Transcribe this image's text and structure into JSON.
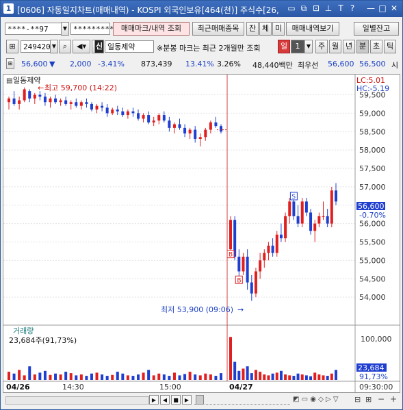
{
  "window": {
    "number": "1",
    "title": "[0606] 자동일지차트(매매내역) - KOSPI 외국인보유[464(천)] 주식수[26,"
  },
  "toolbar1": {
    "account": "****-**97",
    "password": "*********",
    "trade_mark_btn": "매매마크/내역 조회",
    "recent_trades_btn": "최근매매종목",
    "bal_btn": "잔",
    "exec_btn": "체",
    "unexec_btn": "미",
    "view_trades_btn": "매매내역보기",
    "daily_balance_btn": "일별잔고"
  },
  "toolbar2": {
    "stock_code": "249420",
    "credit_badge": "신",
    "stock_name": "일동제약",
    "notice": "※분봉 마크는 최근 2개월만 조회",
    "period_day": "일",
    "period_value": "1",
    "btn_week": "주",
    "btn_month": "월",
    "btn_year": "년",
    "btn_minute": "분",
    "btn_second": "초",
    "btn_tick": "틱"
  },
  "quote": {
    "price": "56,600",
    "arrow": "▼",
    "change": "2,000",
    "change_pct": "-3.41%",
    "volume": "873,439",
    "turnover": "13.41%",
    "ratio": "3.26%",
    "amount": "48,440백만",
    "best_ask_label": "최우선",
    "best_bid": "56,600",
    "best_ask": "56,500",
    "trailing": "시"
  },
  "chart_data": {
    "type": "candlestick",
    "title": "일동제약",
    "high_annotation": "최고 59,700 (14:22)",
    "low_annotation": "최저 53,900 (09:06)",
    "lc_label": "LC:5.01",
    "hc_label": "HC:-5.19",
    "ylim": [
      53500,
      59900
    ],
    "y_ticks": [
      "59,500",
      "59,000",
      "58,500",
      "58,000",
      "57,500",
      "57,000",
      "56,500",
      "56,000",
      "55,500",
      "55,000",
      "54,500",
      "54,000"
    ],
    "current_price_label": "56,600",
    "current_pct_label": "-0.70%",
    "x_labels": [
      "04/26",
      "14:30",
      "15:00",
      "04/27",
      "09:30:00"
    ],
    "marks": [
      {
        "type": "B"
      },
      {
        "type": "B"
      },
      {
        "type": "S"
      }
    ],
    "candles": [
      [
        59300,
        59450,
        59100,
        59400
      ],
      [
        59400,
        59600,
        59200,
        59250
      ],
      [
        59250,
        59450,
        59100,
        59350
      ],
      [
        59350,
        59700,
        59300,
        59650
      ],
      [
        59600,
        59650,
        59300,
        59400
      ],
      [
        59400,
        59550,
        59250,
        59500
      ],
      [
        59500,
        59600,
        59350,
        59450
      ],
      [
        59450,
        59550,
        59200,
        59300
      ],
      [
        59300,
        59450,
        59150,
        59400
      ],
      [
        59400,
        59500,
        59250,
        59300
      ],
      [
        59300,
        59400,
        59200,
        59350
      ],
      [
        59350,
        59450,
        59200,
        59250
      ],
      [
        59250,
        59350,
        59100,
        59300
      ],
      [
        59300,
        59400,
        59150,
        59200
      ],
      [
        59200,
        59350,
        59100,
        59300
      ],
      [
        59300,
        59400,
        59150,
        59250
      ],
      [
        59250,
        59300,
        59050,
        59100
      ],
      [
        59100,
        59250,
        59000,
        59200
      ],
      [
        59200,
        59300,
        59050,
        59150
      ],
      [
        59150,
        59250,
        58900,
        59000
      ],
      [
        59000,
        59150,
        58950,
        59100
      ],
      [
        59100,
        59200,
        58950,
        59050
      ],
      [
        59050,
        59150,
        58900,
        58950
      ],
      [
        58950,
        59100,
        58850,
        59050
      ],
      [
        59050,
        59150,
        58900,
        59000
      ],
      [
        59000,
        59100,
        58800,
        58850
      ],
      [
        58850,
        59000,
        58750,
        58950
      ],
      [
        58950,
        59050,
        58700,
        58750
      ],
      [
        58750,
        58900,
        58650,
        58800
      ],
      [
        58800,
        59000,
        58700,
        58950
      ],
      [
        58950,
        59050,
        58750,
        58800
      ],
      [
        58800,
        58900,
        58500,
        58600
      ],
      [
        58600,
        58750,
        58450,
        58700
      ],
      [
        58700,
        58850,
        58550,
        58600
      ],
      [
        58600,
        58700,
        58350,
        58450
      ],
      [
        58450,
        58600,
        58300,
        58550
      ],
      [
        58550,
        58650,
        58200,
        58300
      ],
      [
        58300,
        58450,
        58100,
        58350
      ],
      [
        58350,
        58600,
        58250,
        58550
      ],
      [
        58550,
        58800,
        58450,
        58750
      ],
      [
        58750,
        58900,
        58600,
        58650
      ],
      [
        58650,
        58700,
        58450,
        58500
      ],
      [
        55300,
        56200,
        55200,
        56100
      ],
      [
        56100,
        56200,
        55000,
        55100
      ],
      [
        55100,
        55300,
        54500,
        54700
      ],
      [
        54700,
        55200,
        54600,
        55100
      ],
      [
        55100,
        55300,
        54200,
        54400
      ],
      [
        54400,
        54600,
        53900,
        54100
      ],
      [
        54100,
        54800,
        54000,
        54700
      ],
      [
        54700,
        55200,
        54500,
        55000
      ],
      [
        55000,
        55300,
        54800,
        55200
      ],
      [
        55200,
        55500,
        55000,
        55400
      ],
      [
        55400,
        55600,
        55100,
        55200
      ],
      [
        55200,
        55800,
        55100,
        55700
      ],
      [
        55700,
        56000,
        55500,
        55600
      ],
      [
        55600,
        56300,
        55500,
        56200
      ],
      [
        56200,
        56700,
        56000,
        56600
      ],
      [
        56600,
        56700,
        56100,
        56200
      ],
      [
        56200,
        56500,
        55900,
        56000
      ],
      [
        56000,
        56700,
        55900,
        56600
      ],
      [
        56600,
        56700,
        56200,
        56300
      ],
      [
        56300,
        56400,
        55700,
        55800
      ],
      [
        55800,
        56100,
        55500,
        56000
      ],
      [
        56000,
        56300,
        55900,
        56200
      ],
      [
        56200,
        56600,
        56100,
        56200
      ],
      [
        56200,
        56400,
        55900,
        56000
      ],
      [
        56000,
        57000,
        55900,
        56900
      ],
      [
        56900,
        57100,
        56500,
        56600
      ]
    ],
    "volume_title": "거래량",
    "volume_value": "23,684주(91,73%)",
    "volume_ytick": "100,000",
    "volume_current": "23,684",
    "volume_pct": "91,73%",
    "volumes": [
      18,
      14,
      22,
      10,
      30,
      12,
      16,
      20,
      11,
      14,
      12,
      18,
      15,
      10,
      12,
      9,
      14,
      16,
      12,
      9,
      11,
      18,
      14,
      10,
      9,
      12,
      16,
      22,
      10,
      14,
      12,
      9,
      16,
      10,
      13,
      18,
      12,
      10,
      14,
      12,
      9,
      15,
      95,
      40,
      20,
      25,
      30,
      15,
      22,
      18,
      12,
      10,
      14,
      16,
      20,
      12,
      10,
      9,
      14,
      12,
      10,
      8,
      16,
      12,
      10,
      9,
      14,
      22
    ]
  },
  "colors": {
    "up": "#e02020",
    "down": "#1f3fd0",
    "title_bar": "#2a58a5",
    "accent": "#d01010"
  }
}
